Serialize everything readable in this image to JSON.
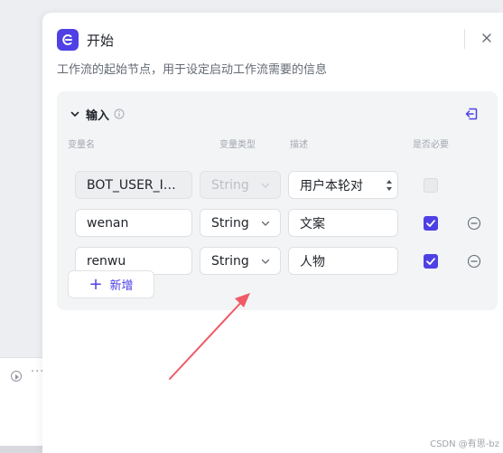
{
  "node": {
    "title": "开始",
    "description": "工作流的起始节点，用于设定启动工作流需要的信息"
  },
  "input_section": {
    "title": "输入",
    "columns": {
      "name": "变量名",
      "type": "变量类型",
      "desc": "描述",
      "required": "是否必要"
    },
    "rows": [
      {
        "name": "BOT_USER_I…",
        "type": "String",
        "desc": "用户本轮对",
        "required": false,
        "locked": true
      },
      {
        "name": "wenan",
        "type": "String",
        "desc": "文案",
        "required": true,
        "locked": false
      },
      {
        "name": "renwu",
        "type": "String",
        "desc": "人物",
        "required": true,
        "locked": false
      }
    ],
    "add_label": "新增"
  },
  "watermark": "CSDN @有思-bz",
  "colors": {
    "accent": "#4e40e5",
    "annotation_arrow": "#f05a66"
  }
}
